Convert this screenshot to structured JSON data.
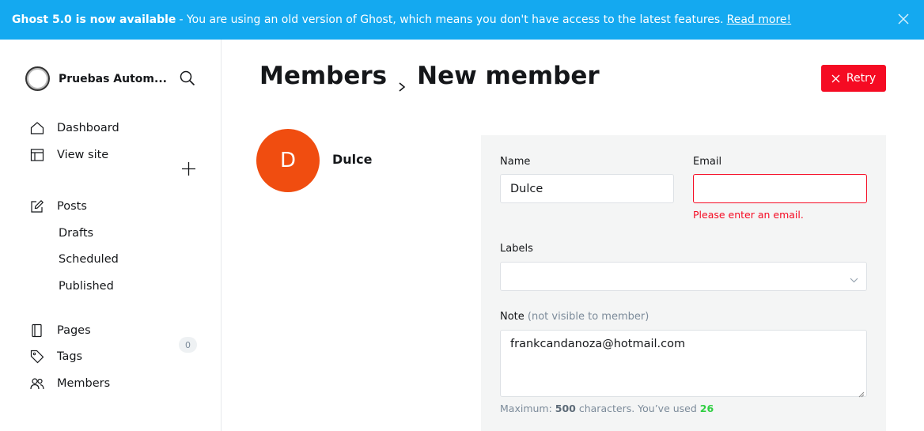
{
  "banner": {
    "title": "Ghost 5.0 is now available",
    "message": " - You are using an old version of Ghost, which means you don't have access to the latest features.",
    "link": "Read more!",
    "close_icon": "close-icon",
    "color": "#14a9f0"
  },
  "sidebar": {
    "site_name": "Pruebas Autom...",
    "nav": [
      {
        "label": "Dashboard",
        "icon": "home-icon"
      },
      {
        "label": "View site",
        "icon": "layout-icon"
      }
    ],
    "posts": {
      "label": "Posts",
      "icon": "edit-icon",
      "sub": [
        "Drafts",
        "Scheduled",
        "Published"
      ]
    },
    "nav2": [
      {
        "label": "Pages",
        "icon": "page-icon"
      },
      {
        "label": "Tags",
        "icon": "tag-icon"
      },
      {
        "label": "Members",
        "icon": "members-icon",
        "count": "0"
      }
    ]
  },
  "header": {
    "breadcrumb_parent": "Members",
    "page_title": "New member",
    "retry_label": "Retry",
    "retry_color": "#f50b23"
  },
  "member": {
    "initial": "D",
    "name": "Dulce",
    "avatar_color": "#f04d10"
  },
  "form": {
    "name_label": "Name",
    "name_value": "Dulce",
    "email_label": "Email",
    "email_value": "",
    "email_error": "Please enter an email.",
    "labels_label": "Labels",
    "note_label": "Note",
    "note_hint": "(not visible to member)",
    "note_value": "frankcandanoza@hotmail.com",
    "counter_prefix": "Maximum: ",
    "counter_max": "500",
    "counter_mid": " characters. You’ve used ",
    "counter_used": "26"
  }
}
